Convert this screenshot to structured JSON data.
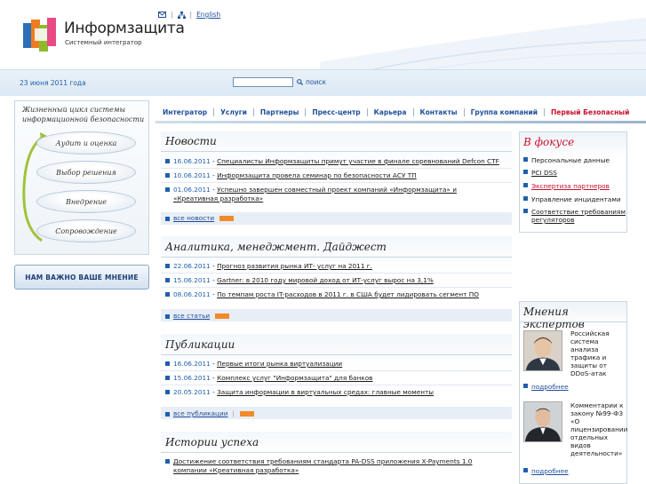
{
  "header": {
    "logo_title": "Информзащита",
    "logo_subtitle": "Системный интегратор",
    "lang_link": "English",
    "icons": [
      "mail-icon",
      "sitemap-icon"
    ]
  },
  "search": {
    "date": "23 июня 2011 года",
    "input_value": "",
    "button_label": "поиск"
  },
  "lifecycle": {
    "title": "Жизненный цикл системы информационной безопасности",
    "stages": [
      "Аудит и оценка",
      "Выбор решения",
      "Внедрение",
      "Сопровождение"
    ]
  },
  "opinion_button": "НАМ ВАЖНО ВАШЕ МНЕНИЕ",
  "nav": {
    "items": [
      "Интегратор",
      "Услуги",
      "Партнеры",
      "Пресс-центр",
      "Карьера",
      "Контакты",
      "Группа компаний",
      "Первый Безопасный"
    ]
  },
  "news": {
    "title": "Новости",
    "items": [
      {
        "date": "16.06.2011",
        "text": "Специалисты Информзащиты примут участие в финале соревнований Defcon CTF"
      },
      {
        "date": "10.06.2011",
        "text": "Информзащита провела семинар по безопасности АСУ ТП"
      },
      {
        "date": "01.06.2011",
        "text": "Успешно завершен совместный проект компаний «Информзащита» и «Креативная разработка»"
      }
    ],
    "more": "все новости",
    "rss": "RSS"
  },
  "analytics": {
    "title": "Аналитика, менеджмент. Дайджест",
    "items": [
      {
        "date": "22.06.2011",
        "text": "Прогноз развития рынка ИТ- услуг на 2011 г."
      },
      {
        "date": "15.06.2011",
        "text": "Gartner: в 2010 году мировой доход от ИТ-услуг вырос на 3,1%"
      },
      {
        "date": "08.06.2011",
        "text": "По темпам роста IT-расходов в 2011 г. в США будет лидировать сегмент ПО"
      }
    ],
    "more": "все статьи",
    "rss": "RSS"
  },
  "publications": {
    "title": "Публикации",
    "items": [
      {
        "date": "16.06.2011",
        "text": "Первые итоги рынка виртуализации"
      },
      {
        "date": "15.06.2011",
        "text": "Комплекс услуг \"Информзащита\" для банков"
      },
      {
        "date": "20.05.2011",
        "text": "Защита информации в виртуальных средах: главные моменты"
      }
    ],
    "more": "все публикации",
    "rss": "RSS"
  },
  "success": {
    "title": "Истории успеха",
    "items": [
      {
        "text": "Достижение соответствия требованиям стандарта PA-DSS приложения X-Payments 1.0 компании «Креативная разработка»"
      }
    ]
  },
  "focus": {
    "title": "В фокусе",
    "items": [
      {
        "text": "Персональные данные",
        "link": false,
        "red": false
      },
      {
        "text": "PCI DSS",
        "link": true,
        "red": false
      },
      {
        "text": "Экспертиза партнеров",
        "link": true,
        "red": true
      },
      {
        "text": "Управление инцидентами",
        "link": false,
        "red": false
      },
      {
        "text": "Соответствие требованиям регуляторов",
        "link": true,
        "red": false
      }
    ]
  },
  "experts": {
    "title": "Мнения экспертов",
    "items": [
      {
        "text": "Российская система анализа трафика и защиты от DDoS-атак",
        "more": "подробнее"
      },
      {
        "text": "Комментарии к закону №99-ФЗ «О лицензировании отдельных видов деятельности»",
        "more": "подробнее"
      }
    ]
  },
  "colors": {
    "link_blue": "#1f4e9c",
    "date_blue": "#1f5fae",
    "accent_red": "#c8102e",
    "rss_orange": "#f28a2c"
  }
}
